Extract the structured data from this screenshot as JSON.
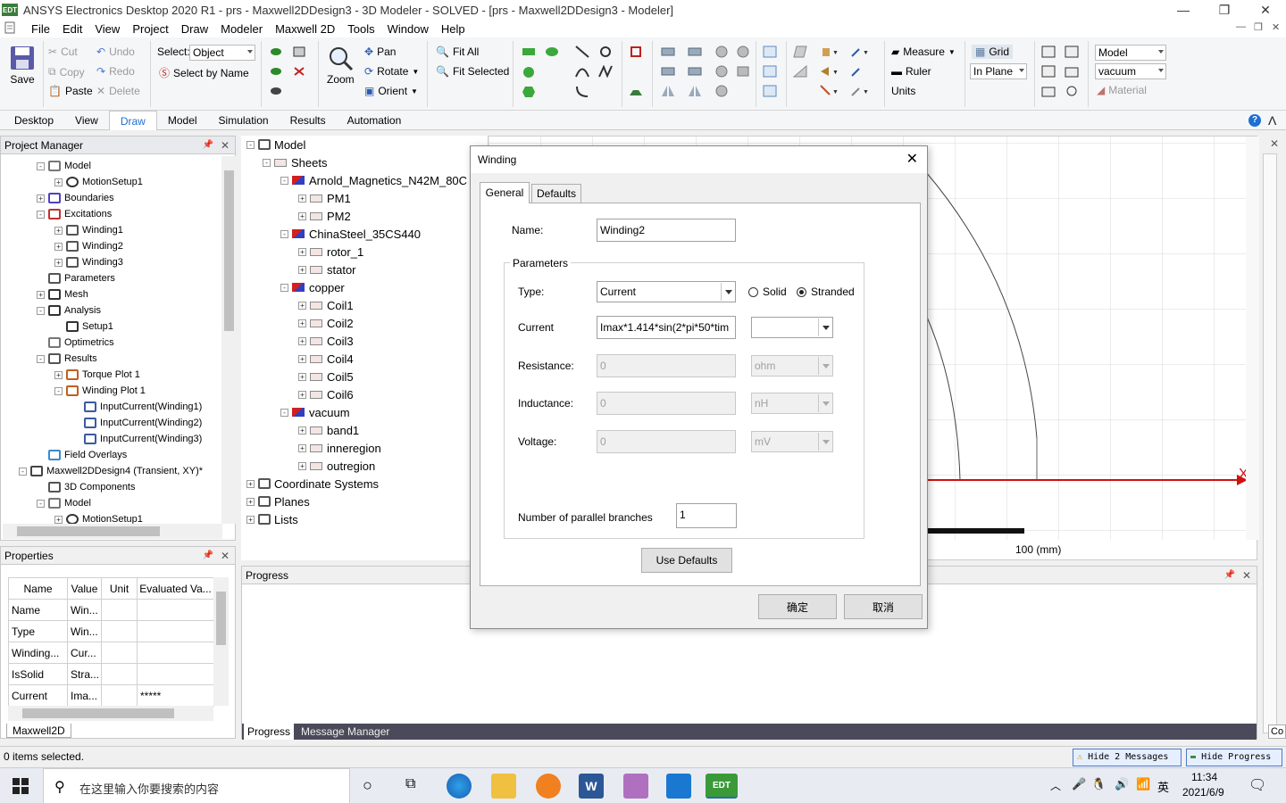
{
  "window": {
    "title": "ANSYS Electronics Desktop 2020 R1 - prs - Maxwell2DDesign3 - 3D Modeler - SOLVED - [prs - Maxwell2DDesign3 - Modeler]",
    "app_icon_text": "EDT"
  },
  "menu": [
    "File",
    "Edit",
    "View",
    "Project",
    "Draw",
    "Modeler",
    "Maxwell 2D",
    "Tools",
    "Window",
    "Help"
  ],
  "ribbon": {
    "save": "Save",
    "cut": "Cut",
    "copy": "Copy",
    "paste": "Paste",
    "undo": "Undo",
    "redo": "Redo",
    "delete": "Delete",
    "select_label": "Select:",
    "select_value": "Object",
    "select_by_name": "Select by Name",
    "zoom": "Zoom",
    "pan": "Pan",
    "rotate": "Rotate",
    "orient": "Orient",
    "fit_all": "Fit All",
    "fit_selected": "Fit Selected",
    "measure": "Measure",
    "ruler": "Ruler",
    "units": "Units",
    "grid": "Grid",
    "in_plane": "In Plane",
    "model_combo": "Model",
    "material_combo": "vacuum",
    "material": "Material"
  },
  "ribbon_tabs": [
    "Desktop",
    "View",
    "Draw",
    "Model",
    "Simulation",
    "Results",
    "Automation"
  ],
  "project_manager": {
    "title": "Project Manager",
    "items": [
      {
        "label": "Model"
      },
      {
        "label": "MotionSetup1"
      },
      {
        "label": "Boundaries"
      },
      {
        "label": "Excitations"
      },
      {
        "label": "Winding1"
      },
      {
        "label": "Winding2"
      },
      {
        "label": "Winding3"
      },
      {
        "label": "Parameters"
      },
      {
        "label": "Mesh"
      },
      {
        "label": "Analysis"
      },
      {
        "label": "Setup1"
      },
      {
        "label": "Optimetrics"
      },
      {
        "label": "Results"
      },
      {
        "label": "Torque Plot 1"
      },
      {
        "label": "Winding Plot 1"
      },
      {
        "label": "InputCurrent(Winding1)"
      },
      {
        "label": "InputCurrent(Winding2)"
      },
      {
        "label": "InputCurrent(Winding3)"
      },
      {
        "label": "Field Overlays"
      },
      {
        "label": "Maxwell2DDesign4 (Transient, XY)*"
      },
      {
        "label": "3D Components"
      },
      {
        "label": "Model"
      },
      {
        "label": "MotionSetup1"
      }
    ]
  },
  "properties": {
    "title": "Properties",
    "headers": [
      "Name",
      "Value",
      "Unit",
      "Evaluated Va..."
    ],
    "rows": [
      [
        "Name",
        "Win...",
        "",
        ""
      ],
      [
        "Type",
        "Win...",
        "",
        ""
      ],
      [
        "Winding...",
        "Cur...",
        "",
        ""
      ],
      [
        "IsSolid",
        "Stra...",
        "",
        ""
      ],
      [
        "Current",
        "Ima...",
        "",
        "*****"
      ]
    ],
    "tab": "Maxwell2D"
  },
  "model_tree": {
    "items": [
      "Model",
      "Sheets",
      "Arnold_Magnetics_N42M_80C",
      "PM1",
      "PM2",
      "ChinaSteel_35CS440",
      "rotor_1",
      "stator",
      "copper",
      "Coil1",
      "Coil2",
      "Coil3",
      "Coil4",
      "Coil5",
      "Coil6",
      "vacuum",
      "band1",
      "inneregion",
      "outregion",
      "Coordinate Systems",
      "Planes",
      "Lists"
    ]
  },
  "viewport": {
    "scale_label": "100 (mm)",
    "axis_x": "X"
  },
  "progress": {
    "title": "Progress",
    "tabs": [
      "Progress",
      "Message Manager"
    ]
  },
  "dialog": {
    "title": "Winding",
    "tabs": [
      "General",
      "Defaults"
    ],
    "name_label": "Name:",
    "name_value": "Winding2",
    "group_label": "Parameters",
    "type_label": "Type:",
    "type_value": "Current",
    "solid": "Solid",
    "stranded": "Stranded",
    "current_label": "Current",
    "current_value": "Imax*1.414*sin(2*pi*50*tim",
    "current_unit": "",
    "resistance_label": "Resistance:",
    "resistance_value": "0",
    "resistance_unit": "ohm",
    "inductance_label": "Inductance:",
    "inductance_value": "0",
    "inductance_unit": "nH",
    "voltage_label": "Voltage:",
    "voltage_value": "0",
    "voltage_unit": "mV",
    "branches_label": "Number of parallel branches",
    "branches_value": "1",
    "use_defaults": "Use Defaults",
    "ok": "确定",
    "cancel": "取消"
  },
  "statusbar": {
    "text": "0 items selected.",
    "hide_messages": "Hide 2 Messages",
    "hide_progress": "Hide Progress"
  },
  "taskbar": {
    "search_placeholder": "在这里输入你要搜索的内容",
    "time": "11:34",
    "date": "2021/6/9",
    "ime": "英"
  }
}
